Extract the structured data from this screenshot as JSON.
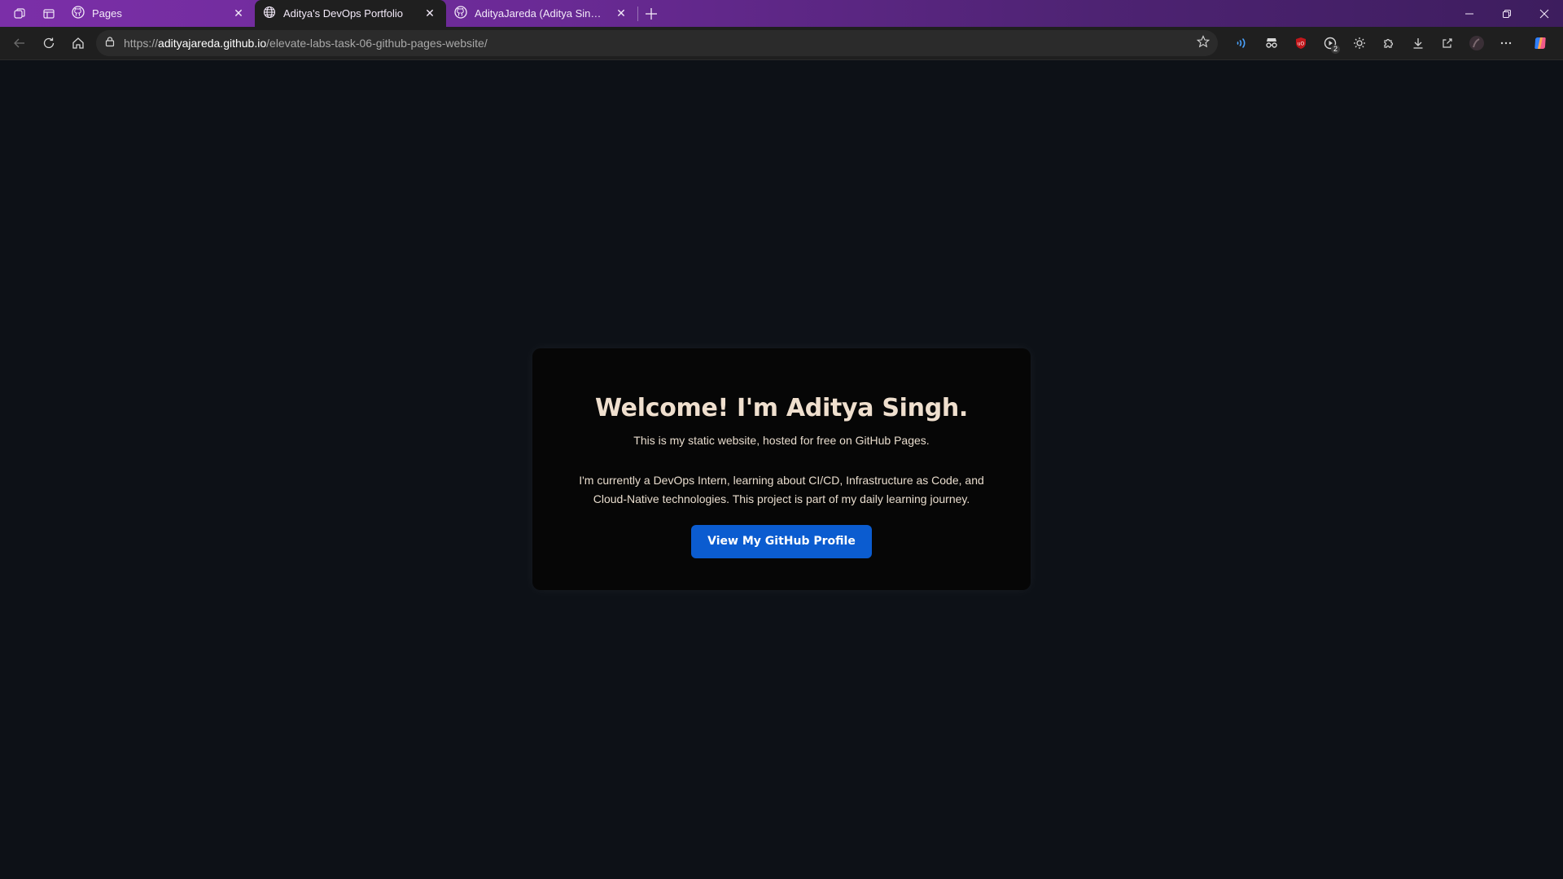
{
  "browser": {
    "tabs": [
      {
        "title": "Pages",
        "icon": "github-icon",
        "active": false
      },
      {
        "title": "Aditya's DevOps Portfolio",
        "icon": "globe-icon",
        "active": true
      },
      {
        "title": "AdityaJareda (Aditya Singh)",
        "icon": "github-icon",
        "active": false
      }
    ],
    "address": {
      "url_prefix": "https://",
      "url_host": "adityajareda.github.io",
      "url_path": "/elevate-labs-task-06-github-pages-website/"
    },
    "extension_badge": "2",
    "theme_colors": {
      "titlebar_start": "#7b2fa8",
      "titlebar_end": "#3d1d5e",
      "button": "#0b5cd0"
    }
  },
  "page": {
    "heading": "Welcome! I'm Aditya Singh.",
    "subtitle": "This is my static website, hosted for free on GitHub Pages.",
    "description": "I'm currently a DevOps Intern, learning about CI/CD, Infrastructure as Code, and Cloud-Native technologies. This project is part of my daily learning journey.",
    "cta_label": "View My GitHub Profile"
  }
}
